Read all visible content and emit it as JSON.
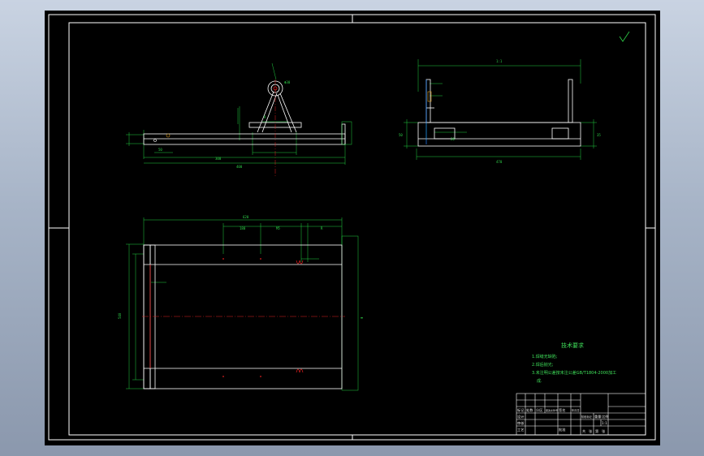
{
  "drawing": {
    "tech_requirements": {
      "title": "技术要求",
      "items": [
        "1.焊缝无缺陷;",
        "2.焊后抛光;",
        "3.未注明公差按未注公差GB/T1804-2000加工",
        "成."
      ]
    },
    "title_block": {
      "checks": [
        "标记",
        "处数",
        "分区",
        "更改文件号",
        "签名",
        "年月日"
      ],
      "roles": [
        "设计",
        "审核",
        "工艺",
        "批准"
      ],
      "stage_labels": [
        "阶段标记",
        "重量",
        "比例"
      ],
      "scale": "1:1",
      "sheet": [
        "共",
        "张",
        "第",
        "张"
      ]
    },
    "colors": {
      "geometry": "#ffffff",
      "dimensions": "#20d040",
      "centerline": "#e02020",
      "background": "#000000"
    }
  }
}
